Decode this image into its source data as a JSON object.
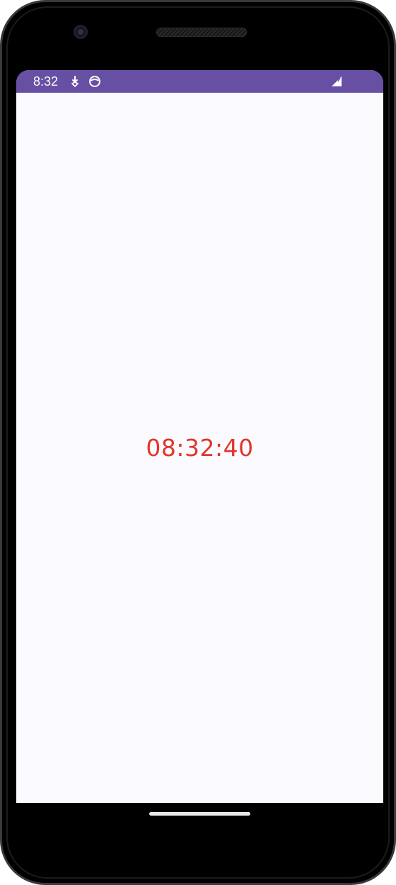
{
  "status_bar": {
    "time": "8:32",
    "icons": [
      "download-arrow-icon",
      "app-circle-icon",
      "signal-icon"
    ],
    "color": "#6750a4"
  },
  "main": {
    "clock_text": "08:32:40",
    "clock_color": "#e0362a",
    "background": "#fbfaff"
  }
}
